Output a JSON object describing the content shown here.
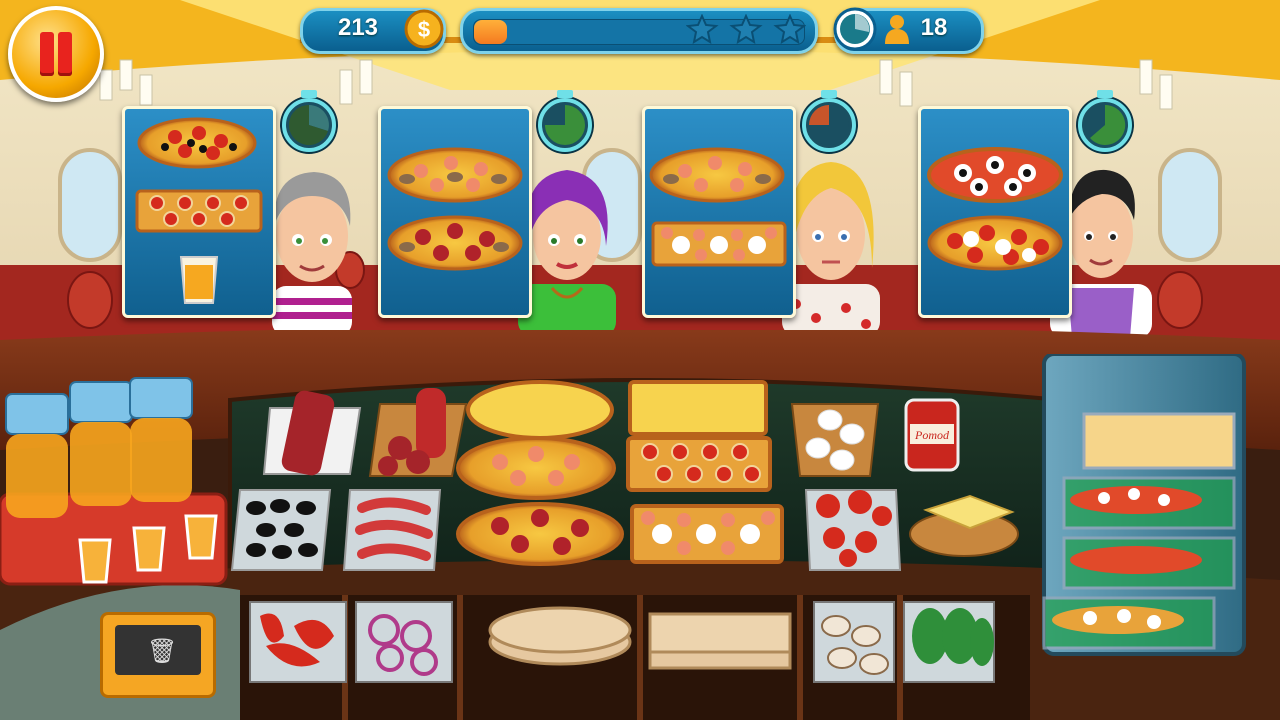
{
  "hud": {
    "pause_icon": "pause-icon",
    "coins": "213",
    "coin_icon": "dollar-coin-icon",
    "level_progress": 0.1,
    "stars_total": 3,
    "customers_left": "18",
    "clock_icon": "clock-icon",
    "customer_icon": "customer-icon"
  },
  "orders": [
    {
      "customer": "gray-haired woman",
      "items": [
        "olive-tomato-pizza",
        "tomato-onion-flatbread",
        "orange-juice"
      ],
      "timer_fraction": 0.3
    },
    {
      "customer": "purple-haired woman",
      "items": [
        "shrimp-mushroom-pizza",
        "salami-mushroom-pizza"
      ],
      "timer_fraction": 0.75
    },
    {
      "customer": "blonde woman",
      "items": [
        "shrimp-mushroom-pizza",
        "shrimp-mozzarella-flatbread"
      ],
      "timer_fraction": 0.2
    },
    {
      "customer": "dark-haired man",
      "items": [
        "olive-mozzarella-pizza",
        "mozzarella-tomato-pizza"
      ],
      "timer_fraction": 0.65
    }
  ],
  "kitchen": {
    "counter_items": [
      "salami",
      "pepperoni",
      "cheese-pizza",
      "cheese-flatbread",
      "mozzarella",
      "tomato-sauce-jar",
      "shrimp-mushroom-pizza",
      "tomato-onion-flatbread",
      "olives",
      "sausages",
      "salami-mushroom-pizza",
      "shrimp-mozzarella-flatbread",
      "tomatoes",
      "cheese-wedge"
    ],
    "sauce_label": "Pomod",
    "lower_bins": [
      "peppers",
      "onions",
      "dough-round",
      "dough-square",
      "mushrooms",
      "lettuce"
    ],
    "juice_machine": "juice-dispenser",
    "trash_icon": "trash-icon",
    "oven": "pizza-oven"
  },
  "colors": {
    "accent": "#1b8fc2",
    "pause": "#f6a800",
    "progress": "#f47a20"
  }
}
